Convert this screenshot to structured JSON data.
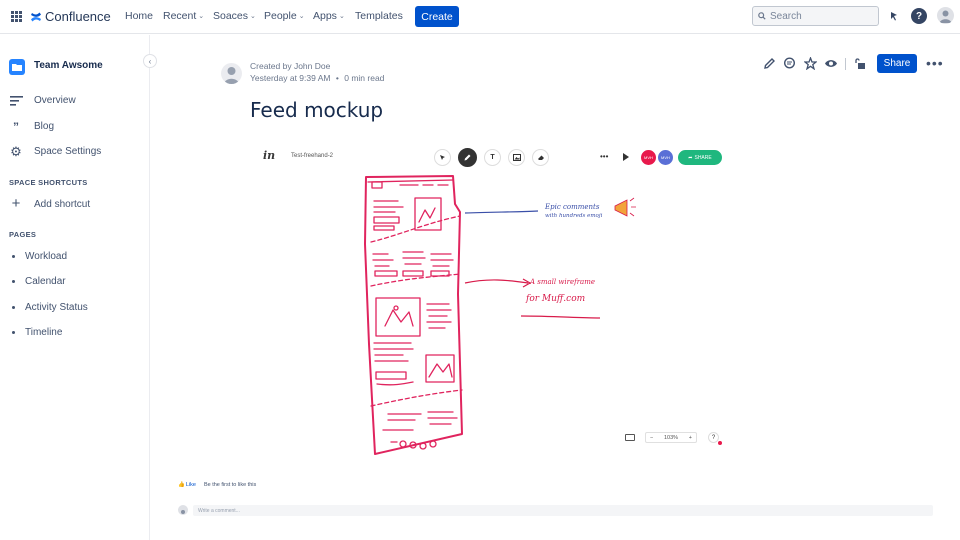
{
  "topnav": {
    "product": "Confluence",
    "items": [
      {
        "label": "Home",
        "dropdown": false
      },
      {
        "label": "Recent",
        "dropdown": true
      },
      {
        "label": "Soaces",
        "dropdown": true
      },
      {
        "label": "People",
        "dropdown": true
      },
      {
        "label": "Apps",
        "dropdown": true
      },
      {
        "label": "Templates",
        "dropdown": false
      }
    ],
    "create_label": "Create",
    "search_placeholder": "Search",
    "help_glyph": "?"
  },
  "sidebar": {
    "space_name": "Team Awsome",
    "items": [
      {
        "label": "Overview",
        "icon": "overview-icon"
      },
      {
        "label": "Blog",
        "icon": "quote-icon"
      },
      {
        "label": "Space Settings",
        "icon": "gear-icon"
      }
    ],
    "shortcuts_heading": "SPACE SHORTCUTS",
    "add_shortcut": "Add shortcut",
    "pages_heading": "PAGES",
    "pages": [
      "Workload",
      "Calendar",
      "Activity Status",
      "Timeline"
    ]
  },
  "page": {
    "created_by": "Created by John Doe",
    "time": "Yesterday at 9:39 AM",
    "separator": "•",
    "read_time": "0 min read",
    "title": "Feed mockup",
    "share_label": "Share"
  },
  "embed": {
    "logo": "in",
    "file_name": "Test-freehand-2",
    "more": "•••",
    "avatars": [
      {
        "initials": "MVH",
        "color": "#E8194C"
      },
      {
        "initials": "MVH",
        "color": "#5A6FD6"
      }
    ],
    "share_label": "SHARE",
    "zoom_minus": "−",
    "zoom_value": "103%",
    "zoom_plus": "+",
    "help_glyph": "?",
    "annotation_1_line1": "Epic comments",
    "annotation_1_line2": "with hundreds emoji",
    "annotation_2_line1": "A small wireframe",
    "annotation_2_line2": "for Muff.com",
    "colors": {
      "sketch": "#E0245E",
      "note_blue": "#3A4FA8",
      "note_red": "#D81B4A"
    }
  },
  "footer": {
    "like_label": "Like",
    "like_text": "Be the first to like this",
    "comment_placeholder": "Write a comment..."
  },
  "colors": {
    "brand": "#0052CC",
    "text": "#172B4D",
    "muted": "#6B778C"
  }
}
